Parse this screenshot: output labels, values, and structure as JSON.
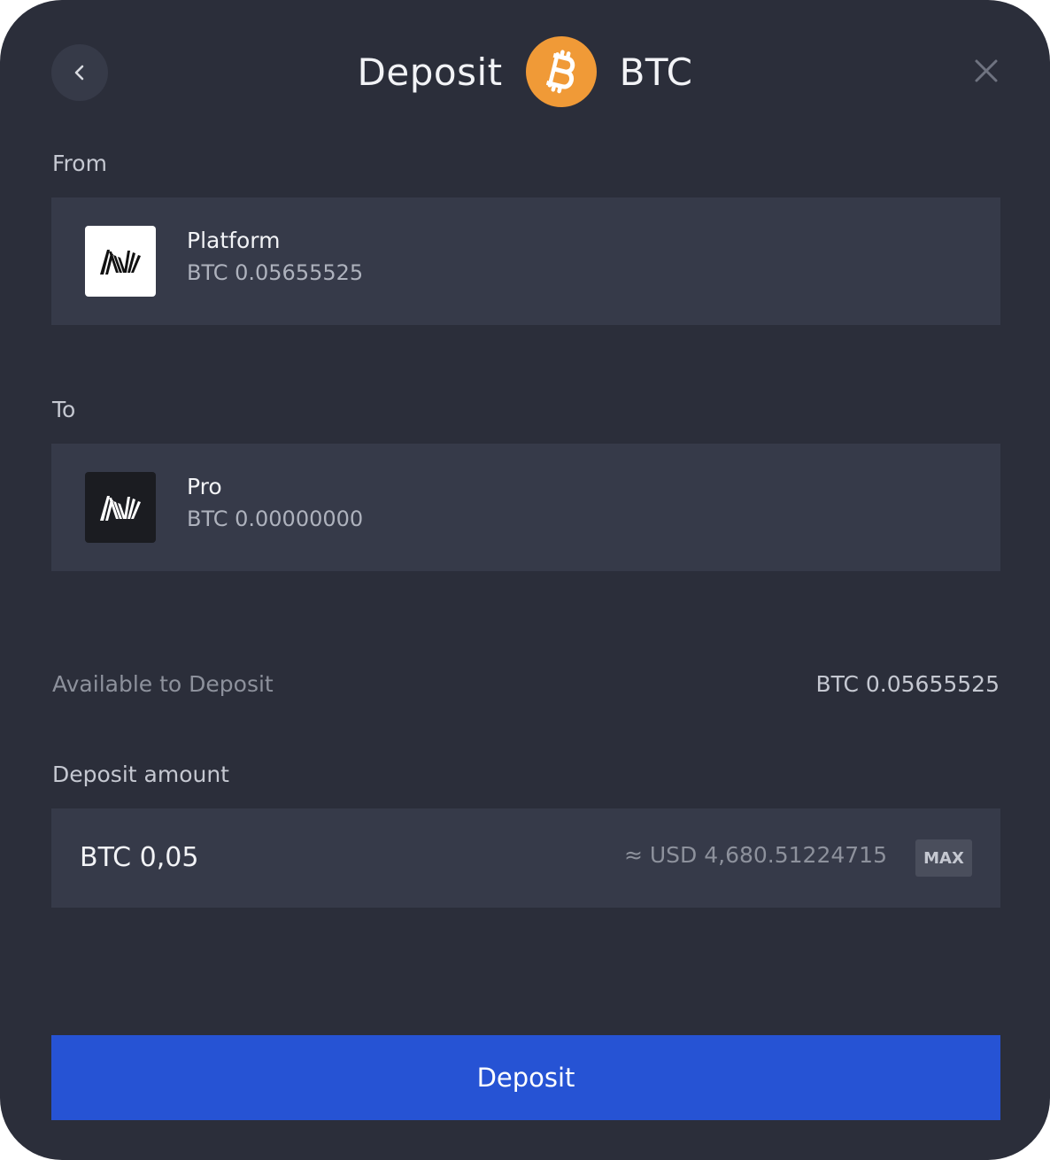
{
  "header": {
    "title": "Deposit",
    "currency": "BTC",
    "coin_icon": "bitcoin-icon",
    "back_icon": "chevron-left-icon",
    "close_icon": "close-icon"
  },
  "from": {
    "label": "From",
    "account_name": "Platform",
    "balance": "BTC 0.05655525",
    "logo": "nexo-logo-light"
  },
  "to": {
    "label": "To",
    "account_name": "Pro",
    "balance": "BTC 0.00000000",
    "logo": "nexo-logo-dark"
  },
  "available": {
    "label": "Available to Deposit",
    "value": "BTC 0.05655525"
  },
  "amount": {
    "label": "Deposit amount",
    "value": "BTC 0,05",
    "usd_equivalent": "≈ USD 4,680.51224715",
    "max_label": "MAX"
  },
  "actions": {
    "deposit_label": "Deposit"
  },
  "colors": {
    "background": "#2b2e3a",
    "card": "#363a49",
    "accent": "#2653d4",
    "bitcoin": "#f09a37"
  }
}
